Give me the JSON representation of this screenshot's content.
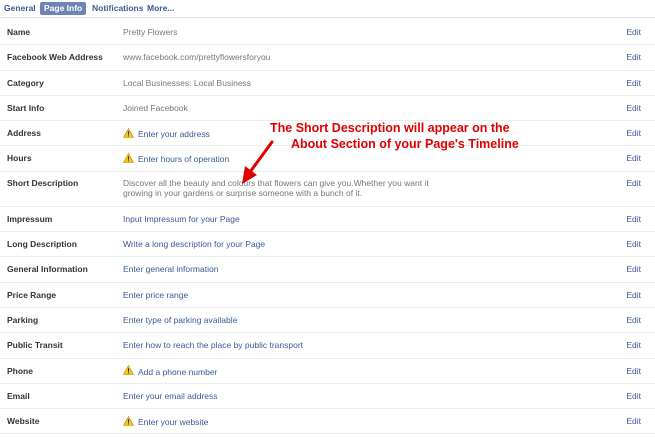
{
  "tabs": [
    {
      "label": "General"
    },
    {
      "label": "Page Info"
    },
    {
      "label": "Notifications"
    },
    {
      "label": "More..."
    }
  ],
  "edit_label": "Edit",
  "rows": [
    {
      "label": "Name",
      "value": "Pretty Flowers"
    },
    {
      "label": "Facebook Web Address",
      "value": "www.facebook.com/prettyflowersforyou"
    },
    {
      "label": "Category",
      "value": "Local Businesses: Local Business"
    },
    {
      "label": "Start Info",
      "value": "Joined Facebook"
    },
    {
      "label": "Address",
      "value": "Enter your address"
    },
    {
      "label": "Hours",
      "value": "Enter hours of operation"
    },
    {
      "label": "Short Description",
      "value": "Discover all the beauty and colours that flowers can give you.Whether you want it growing in your gardens or surprise someone with a bunch of it."
    },
    {
      "label": "Impressum",
      "value": "Input Impressum for your Page"
    },
    {
      "label": "Long Description",
      "value": "Write a long description for your Page"
    },
    {
      "label": "General Information",
      "value": "Enter general information"
    },
    {
      "label": "Price Range",
      "value": "Enter price range"
    },
    {
      "label": "Parking",
      "value": "Enter type of parking available"
    },
    {
      "label": "Public Transit",
      "value": "Enter how to reach the place by public transport"
    },
    {
      "label": "Phone",
      "value": "Add a phone number"
    },
    {
      "label": "Email",
      "value": "Enter your email address"
    },
    {
      "label": "Website",
      "value": "Enter your website"
    }
  ],
  "annotation": {
    "line1": "The Short Description will appear on the",
    "line2": "About Section of your Page's Timeline"
  },
  "colors": {
    "link": "#3b5998",
    "active_tab_bg": "#6d84b4",
    "annotation": "#e00000",
    "warning": "#f5c518"
  },
  "icons": {
    "warning": "warning-triangle-icon",
    "arrow": "arrow-icon"
  }
}
